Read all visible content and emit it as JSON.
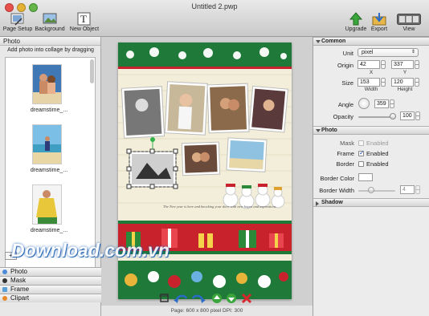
{
  "window": {
    "title": "Untitled 2.pwp"
  },
  "toolbar": {
    "page_setup": "Page Setup",
    "background": "Background",
    "new_object": "New Object",
    "upgrade": "Upgrade",
    "export": "Export",
    "view": "View"
  },
  "left": {
    "header": "Photo",
    "hint": "Add photo into collage by dragging",
    "photos": [
      {
        "label": "dreamstime_..."
      },
      {
        "label": "dreamstime_..."
      },
      {
        "label": "dreamstime_..."
      }
    ],
    "add_label": "+",
    "accordion": [
      "Photo",
      "Mask",
      "Frame",
      "Clipart"
    ]
  },
  "canvas": {
    "greeting": "The New year is here and knocking your door with new hopes and aspirations",
    "watermark": "Download.com.vn"
  },
  "status": {
    "text": "Page: 600 x 800 pixel DPI: 300"
  },
  "inspector": {
    "common_header": "Common",
    "unit_label": "Unit",
    "unit_value": "pixel",
    "origin_label": "Origin",
    "origin_x": "42",
    "origin_y": "337",
    "x_label": "X",
    "y_label": "Y",
    "size_label": "Size",
    "width_value": "153",
    "height_value": "120",
    "width_label": "Width",
    "height_label": "Height",
    "angle_label": "Angle",
    "angle_value": "359",
    "opacity_label": "Opacity",
    "opacity_value": "100",
    "opacity_level": 1.0,
    "photo_header": "Photo",
    "mask_label": "Mask",
    "frame_label": "Frame",
    "border_label": "Border",
    "enabled": "Enabled",
    "border_color_label": "Border Color",
    "border_width_label": "Border Width",
    "border_width_value": "4",
    "shadow_header": "Shadow"
  }
}
